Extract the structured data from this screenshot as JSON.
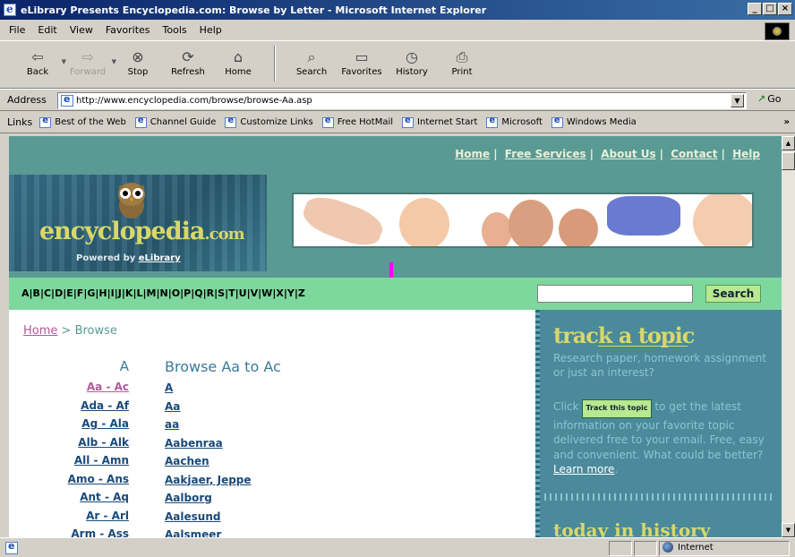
{
  "window": {
    "title": "eLibrary Presents Encyclopedia.com: Browse by Letter - Microsoft Internet Explorer"
  },
  "menu": [
    "File",
    "Edit",
    "View",
    "Favorites",
    "Tools",
    "Help"
  ],
  "toolbar": [
    {
      "label": "Back",
      "icon": "back-arrow-icon"
    },
    {
      "label": "Forward",
      "icon": "forward-arrow-icon"
    },
    {
      "label": "Stop",
      "icon": "stop-icon"
    },
    {
      "label": "Refresh",
      "icon": "refresh-icon"
    },
    {
      "label": "Home",
      "icon": "home-icon"
    },
    {
      "label": "Search",
      "icon": "search-icon"
    },
    {
      "label": "Favorites",
      "icon": "favorites-icon"
    },
    {
      "label": "History",
      "icon": "history-icon"
    },
    {
      "label": "Print",
      "icon": "print-icon"
    }
  ],
  "address": {
    "label": "Address",
    "url": "http://www.encyclopedia.com/browse/browse-Aa.asp",
    "go": "Go"
  },
  "links": {
    "label": "Links",
    "items": [
      "Best of the Web",
      "Channel Guide",
      "Customize Links",
      "Free HotMail",
      "Internet Start",
      "Microsoft",
      "Windows Media"
    ]
  },
  "page": {
    "topnav": [
      "Home",
      "Free Services",
      "About Us",
      "Contact",
      "Help"
    ],
    "logo": {
      "text": "encyclopedia",
      "suffix": ".com",
      "powered_prefix": "Powered by",
      "powered_brand": "eLibrary"
    },
    "letters": [
      "A",
      "B",
      "C",
      "D",
      "E",
      "F",
      "G",
      "H",
      "I",
      "J",
      "K",
      "L",
      "M",
      "N",
      "O",
      "P",
      "Q",
      "R",
      "S",
      "T",
      "U",
      "V",
      "W",
      "X",
      "Y",
      "Z"
    ],
    "search": {
      "button": "Search",
      "value": ""
    },
    "breadcrumb": {
      "home": "Home",
      "sep": ">",
      "current": "Browse"
    },
    "letter_heading": "A",
    "ranges": [
      "Aa - Ac",
      "Ada - Af",
      "Ag - Ala",
      "Alb - Alk",
      "All - Amn",
      "Amo - Ans",
      "Ant - Aq",
      "Ar - Arl",
      "Arm - Ass"
    ],
    "browse_heading": "Browse Aa to Ac",
    "entries": [
      "A",
      "Aa",
      "aa",
      "Aabenraa",
      "Aachen",
      "Aakjaer, Jeppe",
      "Aalborg",
      "Aalesund",
      "Aalsmeer"
    ],
    "sidebar": {
      "title": "track a topic",
      "intro": "Research paper, homework assignment or just an interest?",
      "click": "Click",
      "button": "Track this topic",
      "rest": "to get the latest information on your favorite topic delivered free to your email. Free, easy and convenient. What could be better?",
      "learn": "Learn more",
      "today": "today in history"
    }
  },
  "status": {
    "zone": "Internet"
  }
}
